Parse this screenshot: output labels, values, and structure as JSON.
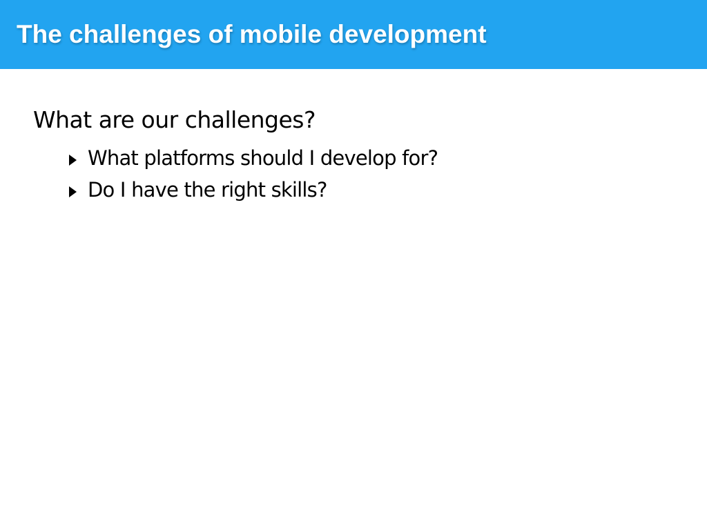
{
  "slide": {
    "title": "The challenges of mobile development",
    "heading": "What are our challenges?",
    "bullets": [
      {
        "text": "What platforms should I develop for?",
        "icon": "triangle-bullet-icon"
      },
      {
        "text": "Do I have the right skills?",
        "icon": "triangle-bullet-icon"
      }
    ]
  },
  "colors": {
    "title_bar": "#22a4f0",
    "title_text": "#ffffff",
    "body_text": "#000000",
    "background": "#ffffff"
  }
}
